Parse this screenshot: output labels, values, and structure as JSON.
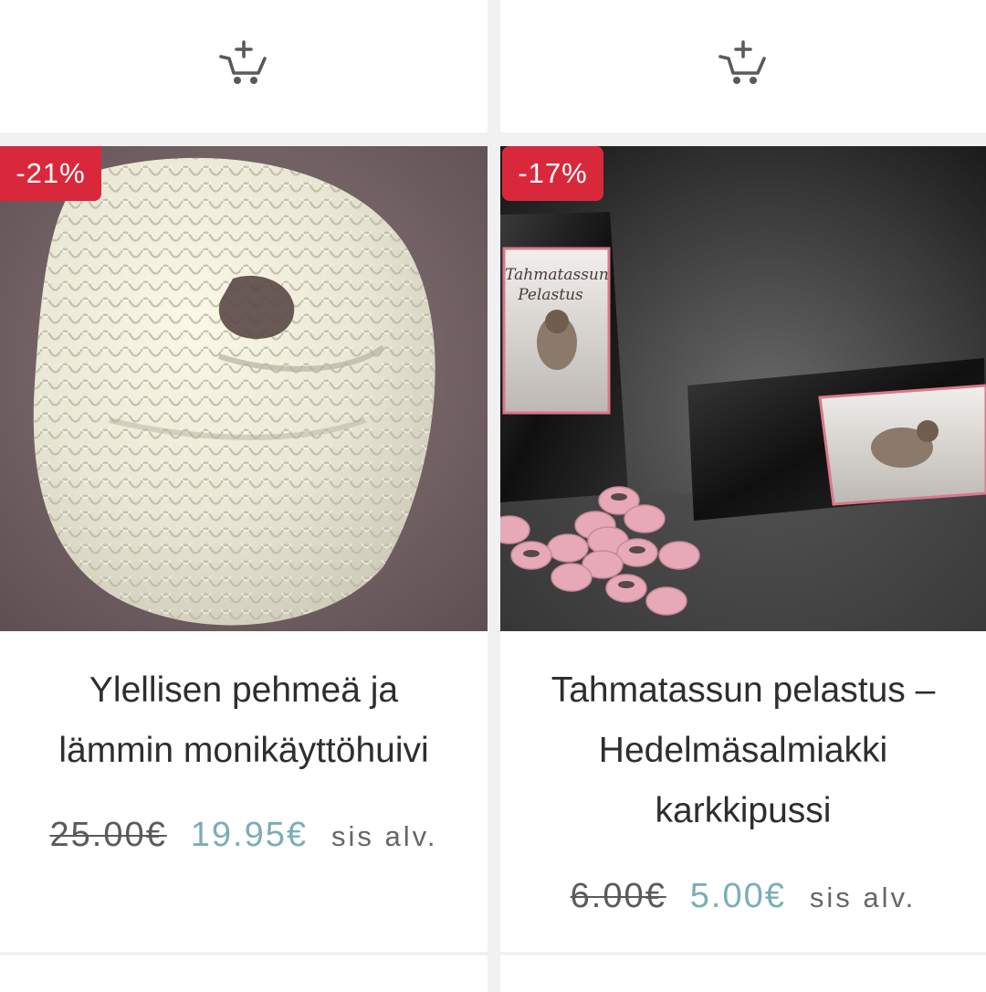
{
  "colors": {
    "badge_bg": "#d9283c",
    "sale_price": "#7aaeb8",
    "text": "#2e2e2e"
  },
  "products": [
    {
      "discount_badge": "-21%",
      "title_line1": "Ylellisen pehmeä ja",
      "title_line2": "lämmin monikäyttöhuivi",
      "title_line3": "",
      "old_price": "25.00€",
      "new_price": "19.95€",
      "tax_note": "sis alv.",
      "cart_icon": "add-to-cart-icon"
    },
    {
      "discount_badge": "-17%",
      "title_line1": "Tahmatassun pelastus –",
      "title_line2": "Hedelmäsalmiakki",
      "title_line3": "karkkipussi",
      "old_price": "6.00€",
      "new_price": "5.00€",
      "tax_note": "sis alv.",
      "cart_icon": "add-to-cart-icon",
      "package_label_line1": "Tahmatassun",
      "package_label_line2": "Pelastus"
    }
  ]
}
